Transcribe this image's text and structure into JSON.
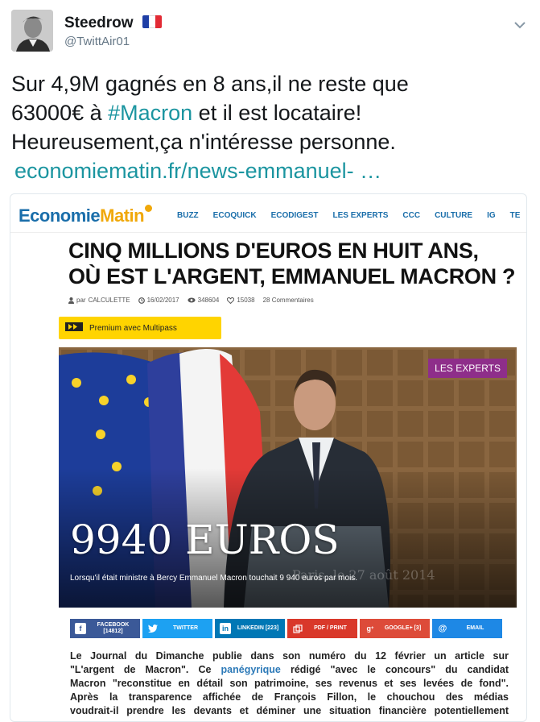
{
  "tweet": {
    "display_name": "Steedrow",
    "handle": "@TwittAir01",
    "text_line1": "Sur 4,9M gagnés en 8 ans,il ne reste que",
    "text_line2_a": "63000€ à ",
    "text_line2_hashtag": "#Macron",
    "text_line2_b": " et il est locataire!",
    "text_line3": "Heureusement,ça n'intéresse personne.",
    "link": "economiematin.fr/news-emmanuel- …",
    "icons": {
      "flag": "france-flag-icon",
      "caret": "chevron-down-icon"
    },
    "colors": {
      "link": "#1b95a0",
      "handle": "#657786"
    }
  },
  "site": {
    "logo_a": "Economie",
    "logo_b": "Matin",
    "nav": [
      "BUZZ",
      "ECOQUICK",
      "ECODIGEST",
      "LES EXPERTS",
      "CCC",
      "CULTURE",
      "IG",
      "TE"
    ]
  },
  "article": {
    "headline_line1": "CINQ MILLIONS D'EUROS EN HUIT ANS,",
    "headline_line2": "OÙ EST L'ARGENT, EMMANUEL MACRON ?",
    "meta": {
      "author_prefix": "par",
      "author": "CALCULETTE",
      "date": "16/02/2017",
      "views": "348604",
      "likes": "15038",
      "comments": "28 Commentaires"
    },
    "premium_label": "Premium avec Multipass",
    "hero": {
      "badge": "LES EXPERTS",
      "title": "9940 EUROS",
      "caption": "Lorsqu'il était ministre à Bercy Emmanuel Macron touchait 9 940 euros par mois.",
      "background_text": "Paris, le 27 août 2014"
    },
    "shares": [
      {
        "label": "FACEBOOK",
        "count": "[14812]",
        "color": "#3b5998",
        "icon": "facebook-icon"
      },
      {
        "label": "TWITTER",
        "count": "",
        "color": "#1da1f2",
        "icon": "twitter-icon"
      },
      {
        "label": "LINKEDIN [223]",
        "count": "",
        "color": "#0077b5",
        "icon": "linkedin-icon"
      },
      {
        "label": "PDF / PRINT",
        "count": "",
        "color": "#d9382a",
        "icon": "print-icon"
      },
      {
        "label": "GOOGLE+ [3]",
        "count": "",
        "color": "#dd4b39",
        "icon": "google-plus-icon"
      },
      {
        "label": "EMAIL",
        "count": "",
        "color": "#1e88e5",
        "icon": "email-icon"
      }
    ],
    "body": {
      "l1": "Le Journal du Dimanche publie dans son numéro du 12 février un article sur",
      "l2_a": "\"L'argent de Macron\". Ce ",
      "l2_link": "panégyrique",
      "l2_b": " rédigé \"avec le concours\" du candidat",
      "l3": "Macron \"reconstitue en détail son patrimoine, ses revenus et ses levées de fond\".",
      "l4": "Après la transparence affichée de François Fillon, le chouchou des médias",
      "l5": "voudrait-il prendre les devants et déminer une situation financière potentiellement"
    }
  }
}
